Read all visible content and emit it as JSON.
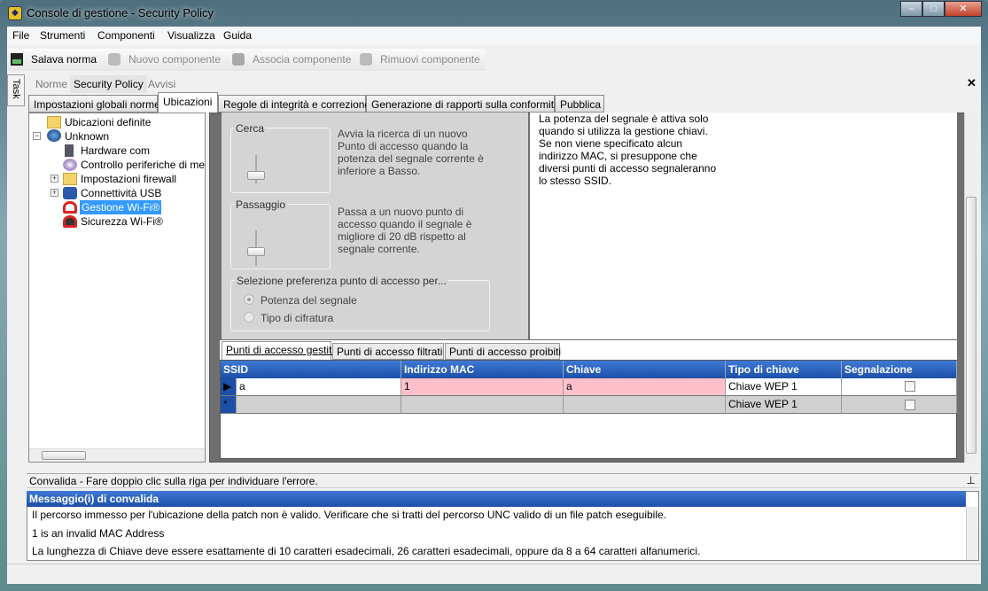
{
  "window": {
    "title": "Console di gestione  - Security Policy"
  },
  "menu": [
    "File",
    "Strumenti",
    "Componenti",
    "Visualizza",
    "Guida"
  ],
  "toolbar": {
    "save": "Salava norma",
    "new": "Nuovo componente",
    "associate": "Associa componente",
    "remove": "Rimuovi componente"
  },
  "task_tab": "Task",
  "doc_tabs": [
    "Norme",
    "Security Policy",
    "Avvisi"
  ],
  "tabs": [
    "Impostazioni globali norme",
    "Ubicazioni",
    "Regole di integrità e correzione",
    "Generazione di rapporti sulla conformità",
    "Pubblica"
  ],
  "tree": {
    "root": "Ubicazioni definite",
    "location": "Unknown",
    "items": [
      "Hardware com",
      "Controllo periferiche di me",
      "Impostazioni firewall",
      "Connettività USB",
      "Gestione Wi-Fi®",
      "Sicurezza Wi-Fi®"
    ]
  },
  "settings": {
    "search_label": "Cerca",
    "search_desc": "Avvia la ricerca di un nuovo Punto di accesso quando la potenza del segnale corrente è inferiore a Basso.",
    "handoff_label": "Passaggio",
    "handoff_desc": "Passa a un nuovo punto di accesso quando il segnale è migliore di 20 dB rispetto al segnale corrente.",
    "pref_label": "Selezione preferenza punto di accesso per...",
    "pref_options": [
      "Potenza del segnale",
      "Tipo di cifratura"
    ],
    "note": "La potenza del segnale è attiva solo quando si utilizza la gestione chiavi. Se non viene specificato alcun indirizzo MAC, si presuppone che diversi punti di accesso segnaleranno lo stesso SSID."
  },
  "ap_tabs": [
    "Punti di accesso gestiti",
    "Punti di accesso filtrati",
    "Punti di accesso proibiti"
  ],
  "grid": {
    "columns": [
      "SSID",
      "Indirizzo MAC",
      "Chiave",
      "Tipo di chiave",
      "Segnalazione"
    ],
    "rows": [
      {
        "ssid": "a",
        "mac": "1",
        "key": "a",
        "type": "Chiave WEP 1",
        "flag": false
      },
      {
        "ssid": "",
        "mac": "",
        "key": "",
        "type": "Chiave WEP 1",
        "flag": false
      }
    ]
  },
  "validation": {
    "bar": "Convalida - Fare doppio clic sulla riga per individuare l'errore.",
    "header": "Messaggio(i) di convalida",
    "messages": [
      "Il percorso immesso per l'ubicazione della patch non è valido. Verificare che si tratti del percorso UNC valido di un file patch eseguibile.",
      "1 is an invalid MAC Address",
      "La lunghezza di Chiave deve essere esattamente di 10 caratteri esadecimali, 26 caratteri esadecimali, oppure da 8 a 64 caratteri alfanumerici."
    ]
  },
  "colors": {
    "header_blue": "#1d4fa8",
    "error_pink": "#ffc0cb",
    "selection": "#3399ff"
  }
}
